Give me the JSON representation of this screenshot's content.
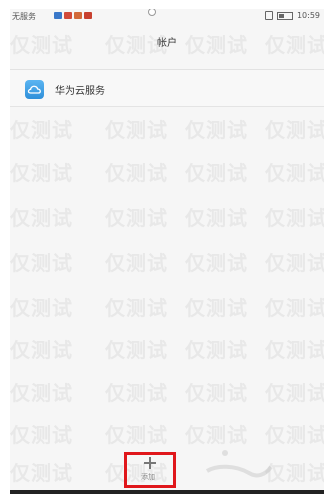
{
  "status_bar": {
    "carrier": "无服务",
    "time": "10:59",
    "notification_colors": [
      "#3a78c9",
      "#d24a3a",
      "#d26a3a",
      "#c8402f"
    ]
  },
  "header": {
    "title": "帐户"
  },
  "accounts": [
    {
      "label": "华为云服务",
      "icon": "huawei-cloud-icon"
    }
  ],
  "bottom_bar": {
    "add_icon": "plus-icon",
    "add_label": "添加"
  },
  "watermark": {
    "text": "仅测试"
  },
  "colors": {
    "highlight": "#e0171b",
    "cloud_icon": "#2f8fd9"
  }
}
